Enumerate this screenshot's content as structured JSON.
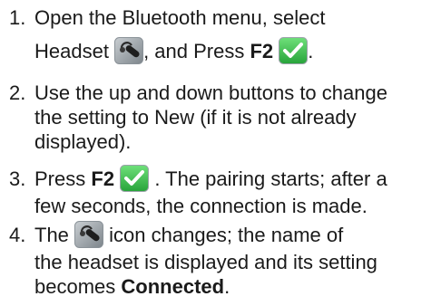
{
  "icons": {
    "headset": "headset-icon",
    "confirm": "checkmark-confirm-icon"
  },
  "colors": {
    "text": "#1a1a1a",
    "confirm_green": "#3cc84a"
  },
  "steps": [
    {
      "number": "1.",
      "l1": "Open the Bluetooth menu, select",
      "l2a": "Headset",
      "l2b": ", and Press",
      "l2key": "F2",
      "l2end": "."
    },
    {
      "number": "2.",
      "l1": "Use the up and down buttons to change",
      "l2": "the setting to New (if it is not already",
      "l3": "displayed)."
    },
    {
      "number": "3.",
      "l1a": "Press",
      "l1key": "F2",
      "l1b": ". The pairing starts; after a",
      "l2": "few seconds, the connection is made."
    },
    {
      "number": "4.",
      "l1a": "The",
      "l1b": "icon changes; the name of",
      "l2": "the headset is displayed and its setting",
      "l3a": "becomes",
      "l3bold": "Connected",
      "l3b": "."
    }
  ]
}
